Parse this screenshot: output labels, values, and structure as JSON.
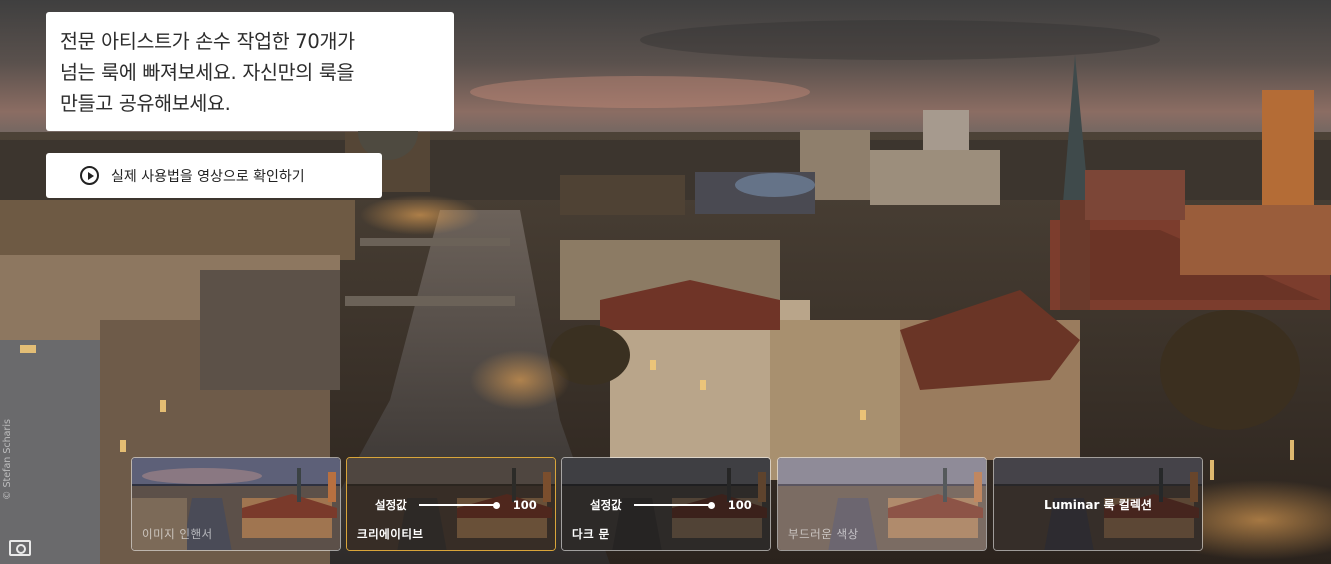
{
  "intro": {
    "line1": "전문 아티스트가 손수 작업한 70개가",
    "line2": "넘는 룩에 빠져보세요. 자신만의 룩을",
    "line3": "만들고 공유해보세요."
  },
  "video_button": {
    "label": "실제 사용법을 영상으로 확인하기"
  },
  "credit": "© Stefan Scharis",
  "thumbs": [
    {
      "label": "이미지 인핸서"
    },
    {
      "label": "크리에이티브",
      "slider_label": "설정값",
      "slider_value": "100",
      "level": 1.0
    },
    {
      "label": "다크 문",
      "slider_label": "설정값",
      "slider_value": "100",
      "level": 1.0
    },
    {
      "label": "부드러운 색상"
    },
    {
      "title": "Luminar 룩 컬렉션"
    }
  ],
  "colors": {
    "active_border": "#d9a53a"
  }
}
